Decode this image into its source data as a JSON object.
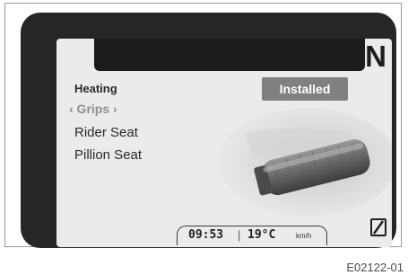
{
  "display": {
    "gear": "N",
    "menu": {
      "title": "Heating",
      "items": [
        {
          "label": "‹ Grips ›"
        },
        {
          "label": "Rider Seat"
        },
        {
          "label": "Pillion Seat"
        }
      ]
    },
    "status_badge": "Installed",
    "status_bar": {
      "time": "09:53",
      "divider": "|",
      "temperature": "19°C",
      "speed_unit": "km/h"
    }
  },
  "figure_code": "E02122-01"
}
